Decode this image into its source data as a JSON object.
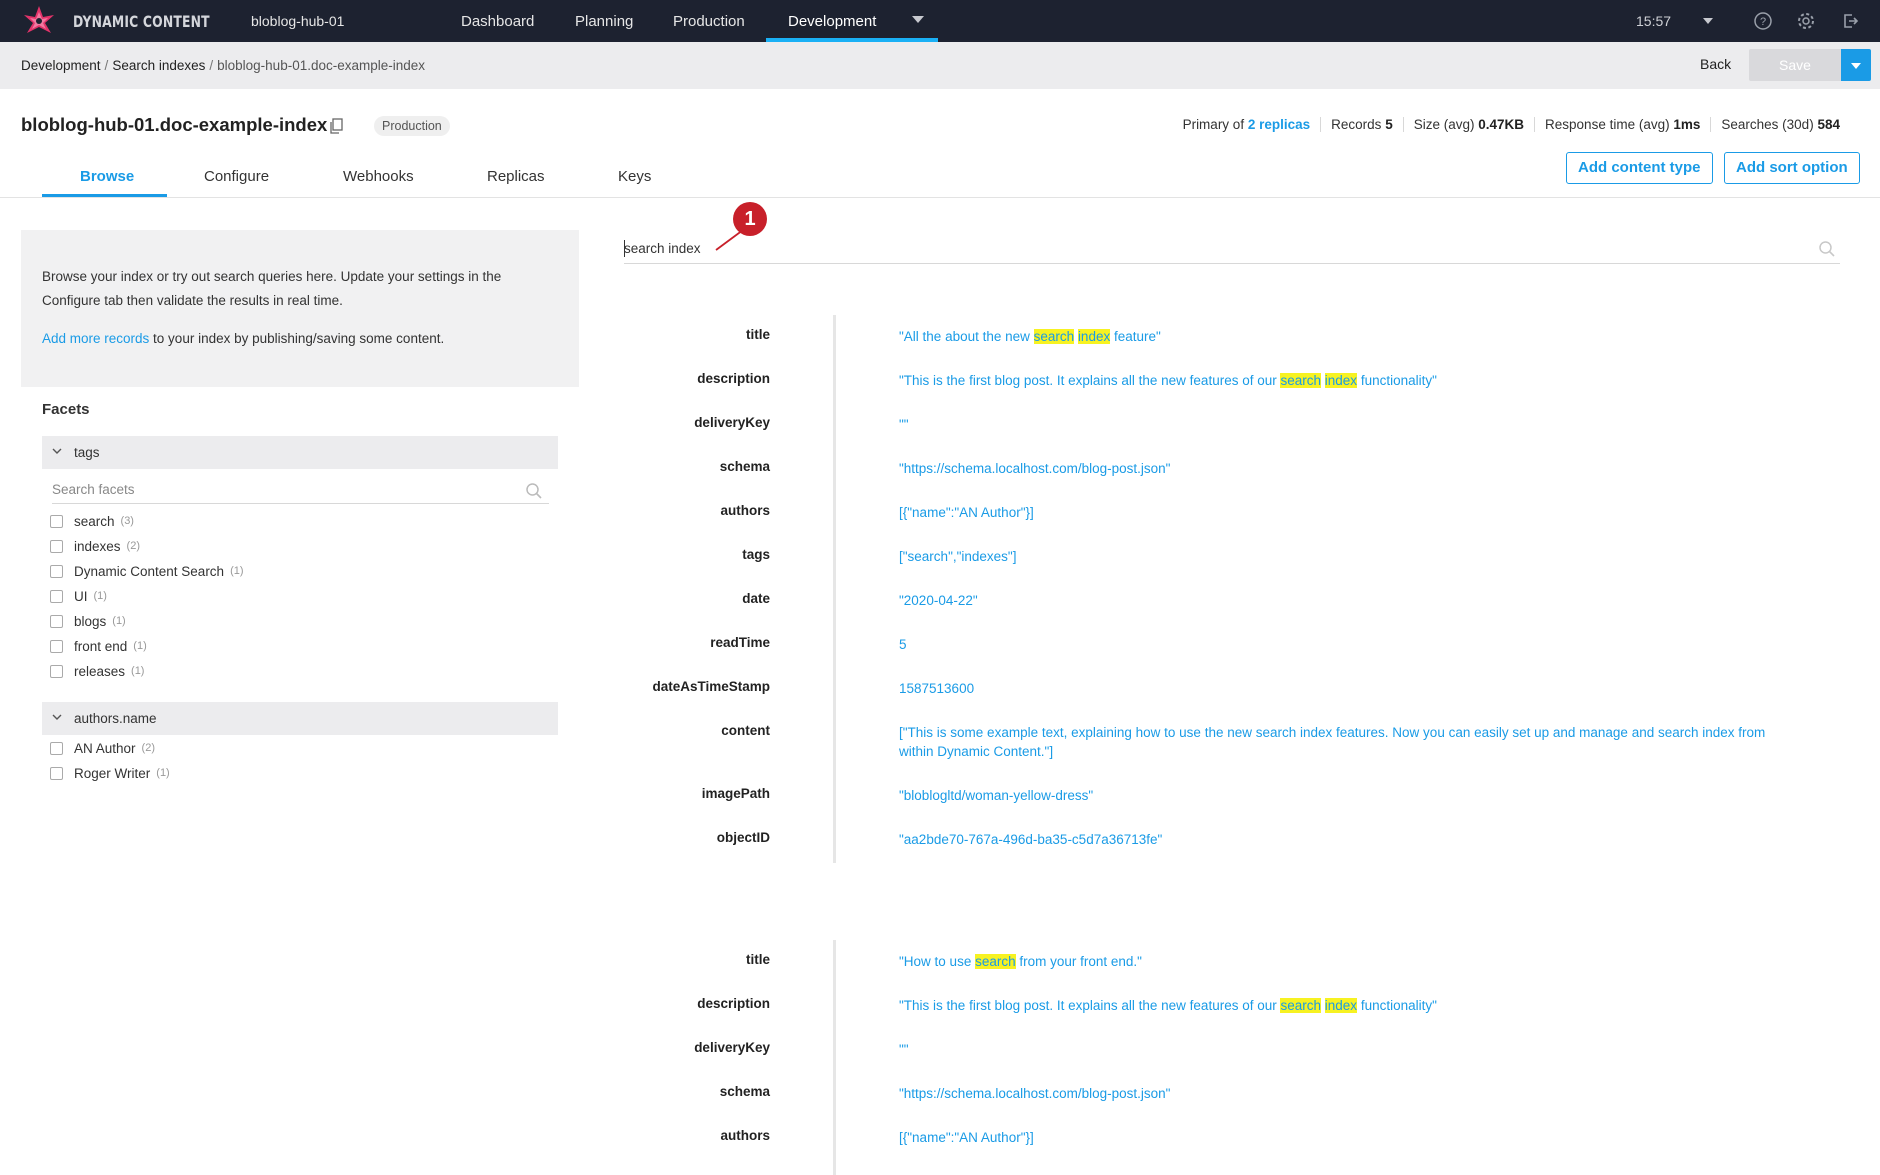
{
  "app": {
    "brand": "DYNAMIC CONTENT",
    "hub": "bloblog-hub-01",
    "nav": [
      "Dashboard",
      "Planning",
      "Production",
      "Development"
    ],
    "active_nav": "Development",
    "time": "15:57"
  },
  "breadcrumb": {
    "items": [
      "Development",
      "Search indexes"
    ],
    "current": "bloblog-hub-01.doc-example-index"
  },
  "actions": {
    "back": "Back",
    "save": "Save"
  },
  "header": {
    "title": "bloblog-hub-01.doc-example-index",
    "badge": "Production",
    "stats": {
      "primary_label": "Primary of",
      "replicas_link": "2 replicas",
      "records_label": "Records",
      "records_value": "5",
      "size_label": "Size (avg)",
      "size_value": "0.47KB",
      "response_label": "Response time (avg)",
      "response_value": "1ms",
      "searches_label": "Searches (30d)",
      "searches_value": "584"
    },
    "add_content_type": "Add content type",
    "add_sort_option": "Add sort option"
  },
  "tabs": [
    "Browse",
    "Configure",
    "Webhooks",
    "Replicas",
    "Keys"
  ],
  "info": {
    "line1": "Browse your index or try out search queries here. Update your settings in the",
    "line2": "Configure tab then validate the results in real time.",
    "link": "Add more records",
    "line3": " to your index by publishing/saving some content."
  },
  "facets": {
    "title": "Facets",
    "search_placeholder": "Search facets",
    "groups": [
      {
        "name": "tags",
        "items": [
          {
            "label": "search",
            "count": "(3)"
          },
          {
            "label": "indexes",
            "count": "(2)"
          },
          {
            "label": "Dynamic Content Search",
            "count": "(1)"
          },
          {
            "label": "UI",
            "count": "(1)"
          },
          {
            "label": "blogs",
            "count": "(1)"
          },
          {
            "label": "front end",
            "count": "(1)"
          },
          {
            "label": "releases",
            "count": "(1)"
          }
        ]
      },
      {
        "name": "authors.name",
        "items": [
          {
            "label": "AN Author",
            "count": "(2)"
          },
          {
            "label": "Roger Writer",
            "count": "(1)"
          }
        ]
      }
    ]
  },
  "search": {
    "value": "search index",
    "callout": "1"
  },
  "records": [
    {
      "fields": [
        {
          "key": "title",
          "parts": [
            [
              "\"All the about the new ",
              false
            ],
            [
              "search",
              true
            ],
            [
              " ",
              false
            ],
            [
              "index",
              true
            ],
            [
              " feature\"",
              false
            ]
          ]
        },
        {
          "key": "description",
          "parts": [
            [
              "\"This is the first blog post. It explains all the new features of our ",
              false
            ],
            [
              "search",
              true
            ],
            [
              " ",
              false
            ],
            [
              "index",
              true
            ],
            [
              " functionality\"",
              false
            ]
          ]
        },
        {
          "key": "deliveryKey",
          "parts": [
            [
              "\"\"",
              false
            ]
          ]
        },
        {
          "key": "schema",
          "parts": [
            [
              "\"https://schema.localhost.com/blog-post.json\"",
              false
            ]
          ]
        },
        {
          "key": "authors",
          "parts": [
            [
              "[{\"name\":\"AN Author\"}]",
              false
            ]
          ]
        },
        {
          "key": "tags",
          "parts": [
            [
              "[\"search\",\"indexes\"]",
              false
            ]
          ]
        },
        {
          "key": "date",
          "parts": [
            [
              "\"2020-04-22\"",
              false
            ]
          ]
        },
        {
          "key": "readTime",
          "parts": [
            [
              "5",
              false
            ]
          ]
        },
        {
          "key": "dateAsTimeStamp",
          "parts": [
            [
              "1587513600",
              false
            ]
          ]
        },
        {
          "key": "content",
          "parts": [
            [
              "[\"This is some example text, explaining how to use the new search index features. Now you can easily set up and manage and search index from within Dynamic Content.\"]",
              false
            ]
          ]
        },
        {
          "key": "imagePath",
          "parts": [
            [
              "\"bloblogltd/woman-yellow-dress\"",
              false
            ]
          ]
        },
        {
          "key": "objectID",
          "parts": [
            [
              "\"aa2bde70-767a-496d-ba35-c5d7a36713fe\"",
              false
            ]
          ]
        }
      ]
    },
    {
      "fields": [
        {
          "key": "title",
          "parts": [
            [
              "\"How to use ",
              false
            ],
            [
              "search",
              true
            ],
            [
              " from your front end.\"",
              false
            ]
          ]
        },
        {
          "key": "description",
          "parts": [
            [
              "\"This is the first blog post. It explains all the new features of our ",
              false
            ],
            [
              "search",
              true
            ],
            [
              " ",
              false
            ],
            [
              "index",
              true
            ],
            [
              " functionality\"",
              false
            ]
          ]
        },
        {
          "key": "deliveryKey",
          "parts": [
            [
              "\"\"",
              false
            ]
          ]
        },
        {
          "key": "schema",
          "parts": [
            [
              "\"https://schema.localhost.com/blog-post.json\"",
              false
            ]
          ]
        },
        {
          "key": "authors",
          "parts": [
            [
              "[{\"name\":\"AN Author\"}]",
              false
            ]
          ]
        }
      ]
    }
  ],
  "colors": {
    "accent": "#1a9be6",
    "nav_bg": "#1d2230",
    "highlight": "#f7f222",
    "callout": "#c8202a"
  }
}
